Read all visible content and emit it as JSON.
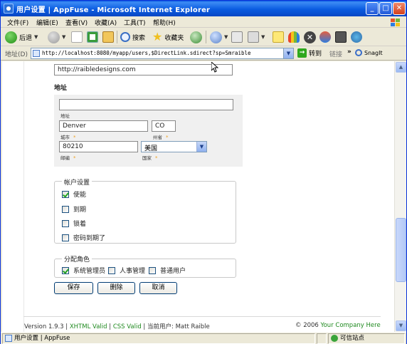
{
  "window": {
    "title": "用户设置 | AppFuse - Microsoft Internet Explorer",
    "min_label": "_",
    "max_label": "□",
    "close_label": "✕"
  },
  "menu": [
    "文件(F)",
    "编辑(E)",
    "查看(V)",
    "收藏(A)",
    "工具(T)",
    "帮助(H)"
  ],
  "toolbar": {
    "back_label": "后退",
    "search_label": "搜索",
    "favorites_label": "收藏夹"
  },
  "address": {
    "label": "地址(D)",
    "url": "http://localhost:8080/myapp/users,$DirectLink.sdirect?sp=Smraible",
    "go_label": "转到",
    "links_label": "链接",
    "snagit_label": "SnagIt"
  },
  "form": {
    "website_value": "http://raibledesigns.com",
    "address_heading": "地址",
    "street": {
      "value": "",
      "label": "地址"
    },
    "city": {
      "value": "Denver",
      "label": "城市"
    },
    "province": {
      "value": "CO",
      "label": "州省"
    },
    "postal": {
      "value": "80210",
      "label": "邮编"
    },
    "country": {
      "value": "美国",
      "label": "国家"
    },
    "required_marker": "*"
  },
  "account_settings": {
    "legend": "帐户设置",
    "options": [
      {
        "label": "使能",
        "checked": true
      },
      {
        "label": "到期",
        "checked": false
      },
      {
        "label": "锁着",
        "checked": false
      },
      {
        "label": "密码到期了",
        "checked": false
      }
    ]
  },
  "roles": {
    "legend": "分配角色",
    "options": [
      {
        "label": "系统管理员",
        "checked": true
      },
      {
        "label": "人事管理",
        "checked": false
      },
      {
        "label": "普通用户",
        "checked": false
      }
    ]
  },
  "buttons": {
    "save": "保存",
    "delete": "删除",
    "cancel": "取消"
  },
  "footer": {
    "version": "Version 1.9.3 | ",
    "xhtml": "XHTML Valid",
    "sep1": " | ",
    "css": "CSS Valid",
    "current_user": " | 当前用户: Matt Raible",
    "copyright": "© 2006 ",
    "company": "Your Company Here"
  },
  "status": {
    "page_label": "用户设置 | AppFuse",
    "zone_label": "可信站点"
  },
  "colors": {
    "titlebar": "#0a5be0",
    "link_green": "#1f8a1f",
    "required": "#f0a020"
  }
}
